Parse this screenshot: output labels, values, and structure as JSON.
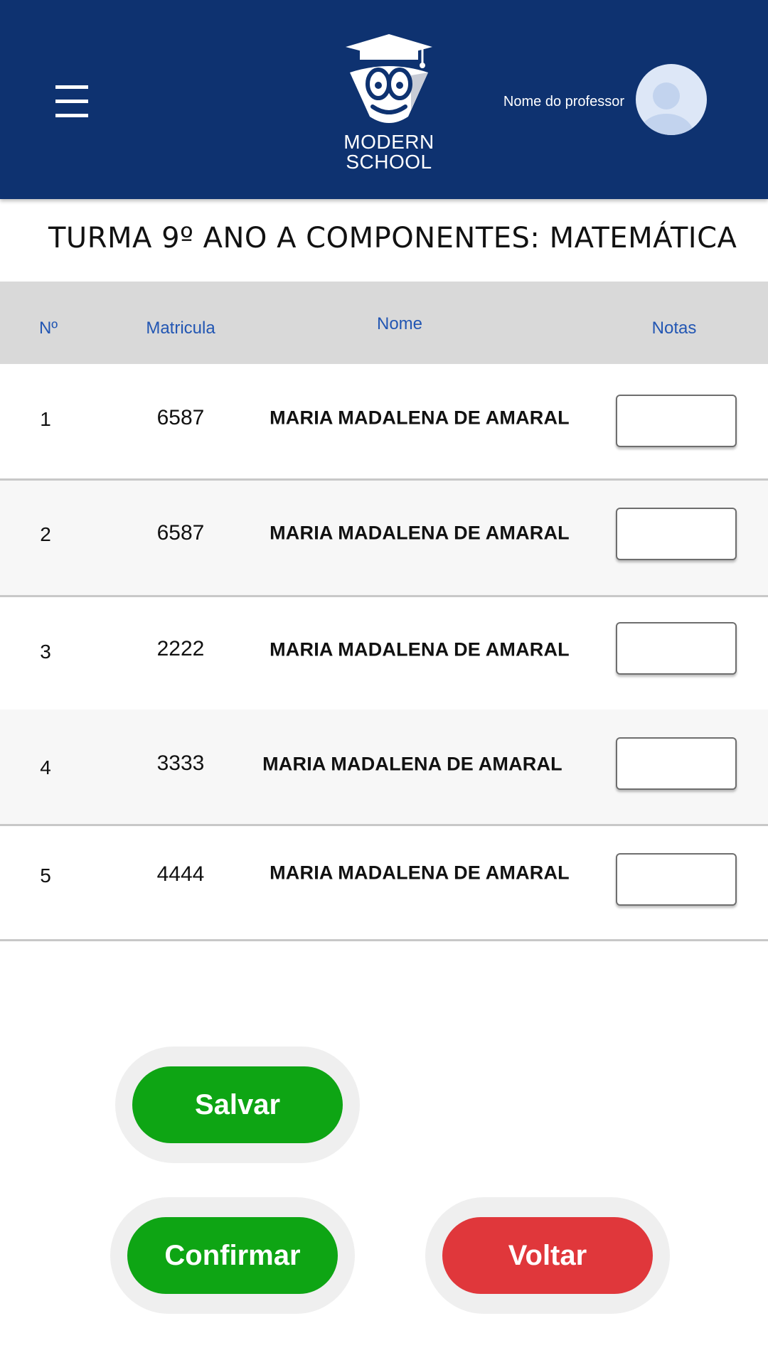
{
  "header": {
    "logo_line1": "MODERN",
    "logo_line2": "SCHOOL",
    "professor_label": "Nome do professor"
  },
  "page_title": "TURMA 9º ANO A COMPONENTES: MATEMÁTICA",
  "table": {
    "columns": [
      "Nº",
      "Matricula",
      "Nome",
      "Notas"
    ],
    "rows": [
      {
        "n": "1",
        "matricula": "6587",
        "nome": "MARIA MADALENA DE AMARAL",
        "nota": ""
      },
      {
        "n": "2",
        "matricula": "6587",
        "nome": "MARIA MADALENA DE AMARAL",
        "nota": ""
      },
      {
        "n": "3",
        "matricula": "2222",
        "nome": "MARIA MADALENA DE AMARAL",
        "nota": ""
      },
      {
        "n": "4",
        "matricula": "3333",
        "nome": "MARIA MADALENA DE AMARAL",
        "nota": ""
      },
      {
        "n": "5",
        "matricula": "4444",
        "nome": "MARIA MADALENA DE AMARAL",
        "nota": ""
      }
    ]
  },
  "buttons": {
    "save": "Salvar",
    "confirm": "Confirmar",
    "back": "Voltar"
  },
  "colors": {
    "header_bg": "#0e3270",
    "accent_text": "#2256b3",
    "green_button": "#0ea514",
    "red_button": "#e0373b"
  },
  "icons": {
    "menu": "hamburger-menu-icon",
    "logo": "owl-graduation-cap-logo",
    "avatar": "user-avatar-icon"
  }
}
